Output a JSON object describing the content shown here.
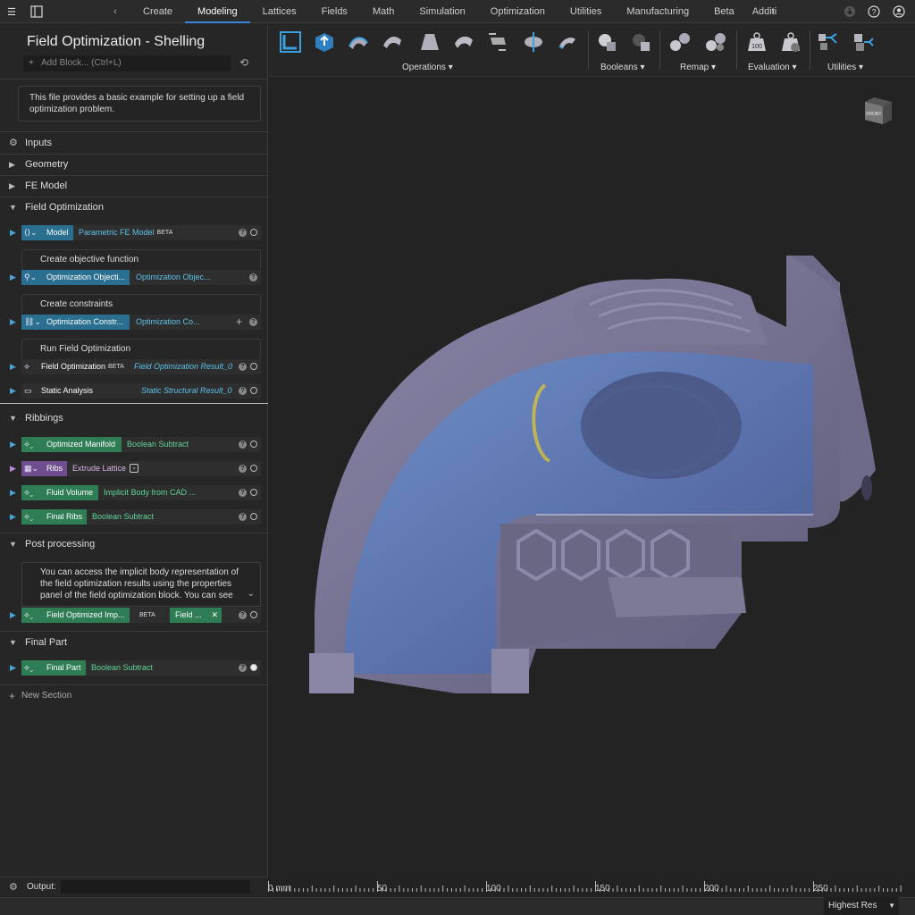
{
  "topbar": {
    "tabs": [
      "Create",
      "Modeling",
      "Lattices",
      "Fields",
      "Math",
      "Simulation",
      "Optimization",
      "Utilities",
      "Manufacturing",
      "Beta",
      "Additi"
    ],
    "active_tab": "Modeling",
    "accent": "#3a86d8"
  },
  "sidebar": {
    "title": "Field Optimization - Shelling",
    "add_block_placeholder": "Add Block... (Ctrl+L)",
    "intro_note": "This file provides a basic example for setting up a field optimization problem.",
    "sections": {
      "inputs": "Inputs",
      "geometry": "Geometry",
      "fe_model": "FE Model",
      "field_opt": "Field Optimization",
      "ribbings": "Ribbings",
      "post": "Post processing",
      "final": "Final Part"
    },
    "field_opt_rows": {
      "model_label": "Model",
      "model_value": "Parametric FE Model",
      "model_badge": "BETA",
      "objective_head": "Create objective function",
      "objective_label": "Optimization Objecti...",
      "objective_value": "Optimization Objec...",
      "constraints_head": "Create constraints",
      "constraints_label": "Optimization Constr...",
      "constraints_value": "Optimization Co...",
      "run_head": "Run Field Optimization",
      "fieldopt_label": "Field Optimization",
      "fieldopt_badge": "BETA",
      "fieldopt_value": "Field Optimization Result_0",
      "static_label": "Static Analysis",
      "static_value": "Static Structural Result_0"
    },
    "ribbing_rows": {
      "r1_label": "Optimized Manifold",
      "r1_value": "Boolean Subtract",
      "r2_label": "Ribs",
      "r2_value": "Extrude Lattice",
      "r3_label": "Fluid Volume",
      "r3_value": "Implicit Body from CAD ...",
      "r4_label": "Final Ribs",
      "r4_value": "Boolean Subtract"
    },
    "post_note": "You can access the implicit body representation of the field optimization results using the properties panel of the field optimization block. You can see",
    "post_row": {
      "label": "Field Optimized Imp...",
      "badge": "BETA",
      "value": "Field ..."
    },
    "final_row": {
      "label": "Final Part",
      "value": "Boolean Subtract"
    },
    "new_section": "New Section",
    "output_label": "Output:"
  },
  "toolbar": {
    "groups": [
      "Operations",
      "Booleans",
      "Remap",
      "Evaluation",
      "Utilities"
    ],
    "evaluation_badge": "100"
  },
  "viewport": {
    "viewcube_label": "FRONT",
    "ruler_labels": [
      "0 mm",
      "50",
      "100",
      "150",
      "200",
      "250"
    ]
  },
  "status": {
    "resolution": "Highest Res"
  }
}
